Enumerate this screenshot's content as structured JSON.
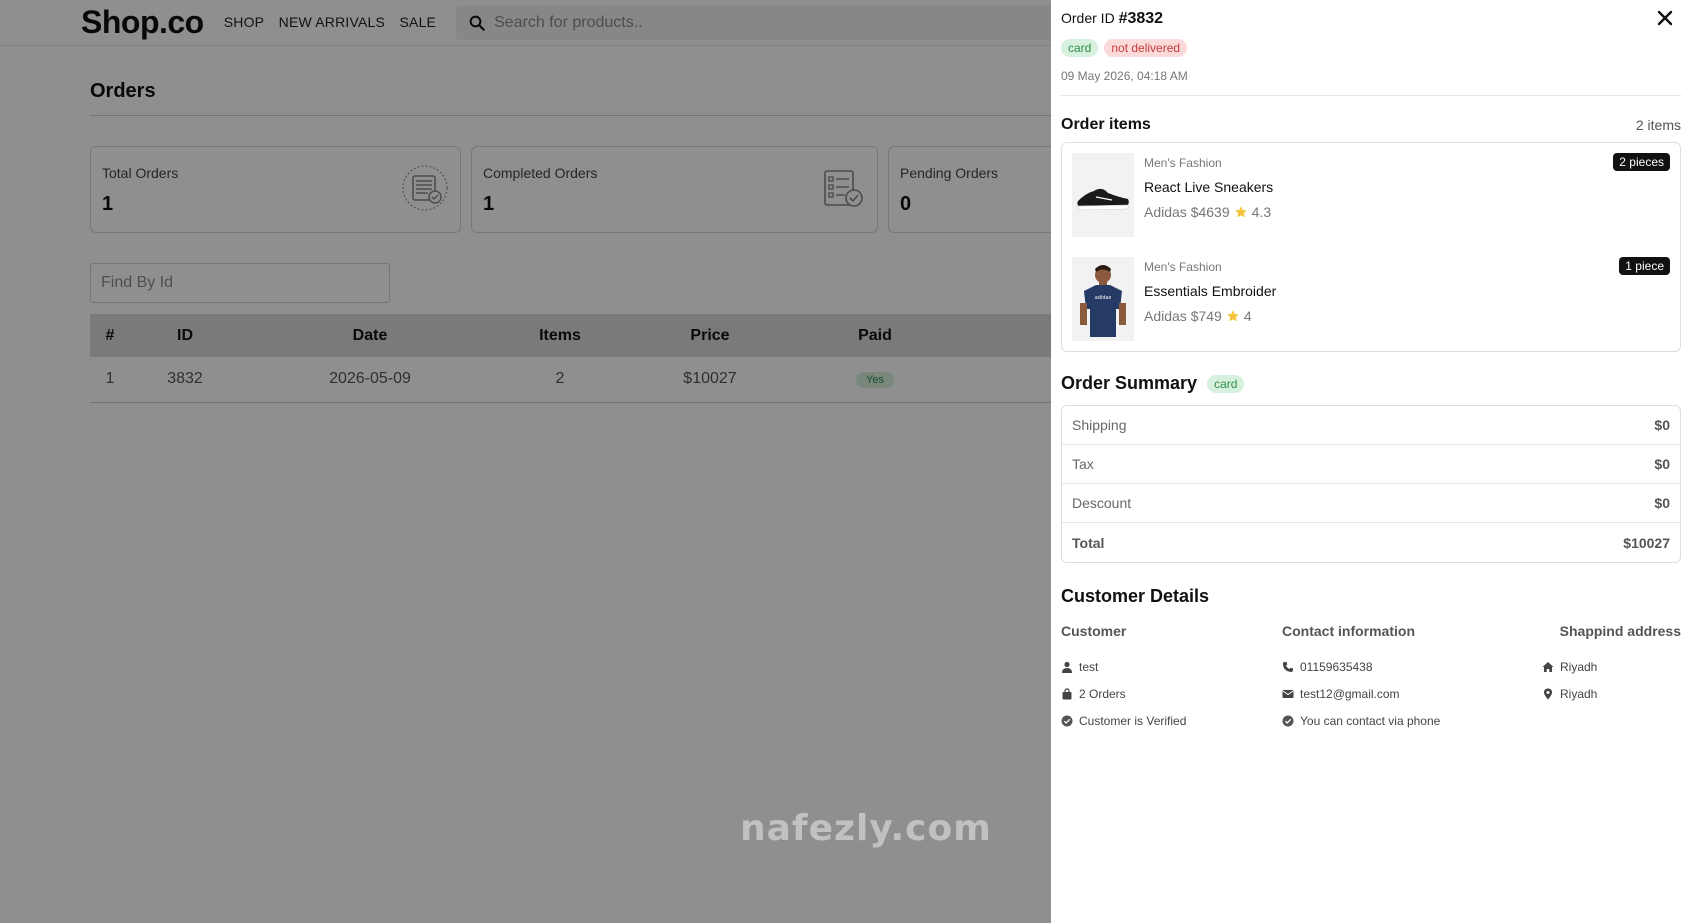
{
  "header": {
    "logo": "Shop.co",
    "nav": [
      "SHOP",
      "NEW ARRIVALS",
      "SALE"
    ],
    "search_placeholder": "Search for products.."
  },
  "orders_page": {
    "title": "Orders",
    "stats": [
      {
        "label": "Total Orders",
        "value": "1"
      },
      {
        "label": "Completed Orders",
        "value": "1"
      },
      {
        "label": "Pending Orders",
        "value": "0"
      }
    ],
    "find_placeholder": "Find By Id",
    "table": {
      "headers": [
        "#",
        "ID",
        "Date",
        "Items",
        "Price",
        "Paid"
      ],
      "rows": [
        {
          "index": "1",
          "id": "3832",
          "date": "2026-05-09",
          "items": "2",
          "price": "$10027",
          "paid": "Yes"
        }
      ]
    }
  },
  "watermark": "nafezly.com",
  "drawer": {
    "order_id_label": "Order ID",
    "order_id": "#3832",
    "payment_badge": "card",
    "status_badge": "not delivered",
    "date": "09 May 2026, 04:18 AM",
    "items_title": "Order items",
    "items_count": "2 items",
    "items": [
      {
        "category": "Men's Fashion",
        "name": "React Live Sneakers",
        "brand_price": "Adidas $4639",
        "rating": "4.3",
        "pieces": "2 pieces"
      },
      {
        "category": "Men's Fashion",
        "name": "Essentials Embroider",
        "brand_price": "Adidas $749",
        "rating": "4",
        "pieces": "1 piece"
      }
    ],
    "summary_title": "Order Summary",
    "summary_badge": "card",
    "summary": [
      {
        "label": "Shipping",
        "value": "$0"
      },
      {
        "label": "Tax",
        "value": "$0"
      },
      {
        "label": "Descount",
        "value": "$0"
      },
      {
        "label": "Total",
        "value": "$10027"
      }
    ],
    "customer_title": "Customer Details",
    "customer": {
      "heading": "Customer",
      "name": "test",
      "orders": "2 Orders",
      "verified": "Customer is Verified"
    },
    "contact": {
      "heading": "Contact information",
      "phone": "01159635438",
      "email": "test12@gmail.com",
      "note": "You can contact via phone"
    },
    "shipping": {
      "heading": "Shappind address",
      "line1": "Riyadh",
      "line2": "Riyadh"
    }
  },
  "colors": {
    "badge_green_text": "#2d8c4a",
    "badge_green_bg": "#d8f1df",
    "badge_red_text": "#c73a3a",
    "badge_red_bg": "#fbdada",
    "star": "#f5c542"
  }
}
